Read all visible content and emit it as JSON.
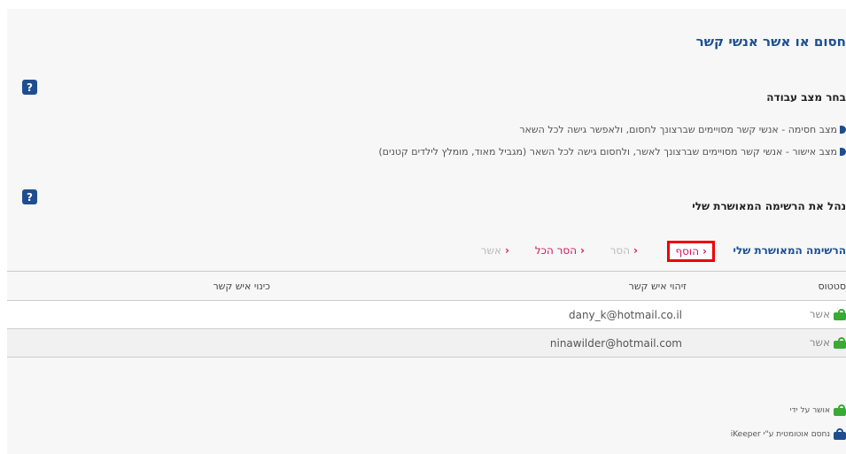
{
  "page": {
    "title": "חסום או אשר אנשי קשר",
    "section1_heading": "בחר מצב עבודה",
    "modes": [
      {
        "label": "מצב חסימה - אנשי קשר מסויימים שברצונך לחסום, ולאפשר גישה לכל השאר"
      },
      {
        "label": "מצב אישור - אנשי קשר מסויימים שברצונך לאשר, ולחסום גישה לכל השאר (מגביל מאוד, מומלץ לילדים קטנים)"
      }
    ],
    "section2_heading": "נהל את הרשימה המאושרת שלי",
    "help_label": "?"
  },
  "toolbar": {
    "list_title": "הרשימה המאושרת שלי",
    "add_label": "הוסף",
    "remove_label": "הסר",
    "remove_all_label": "הסר הכל",
    "approve_label": "אשר",
    "chevron": "‹"
  },
  "table": {
    "headers": {
      "status": "סטטוס",
      "id": "זיהוי איש קשר",
      "nickname": "כינוי איש קשר"
    },
    "rows": [
      {
        "status": "אשר",
        "id": "dany_k@hotmail.co.il",
        "nickname": ""
      },
      {
        "status": "אשר",
        "id": "ninawilder@hotmail.com",
        "nickname": ""
      }
    ]
  },
  "legend": {
    "approved_by_me": "אושר על ידי",
    "auto_blocked": "נחסם אוטומטית ע\"י iKeeper"
  },
  "colors": {
    "accent": "#1d4f91",
    "link": "#d4145a",
    "highlight": "#ee0000",
    "approved": "#3aa935"
  }
}
